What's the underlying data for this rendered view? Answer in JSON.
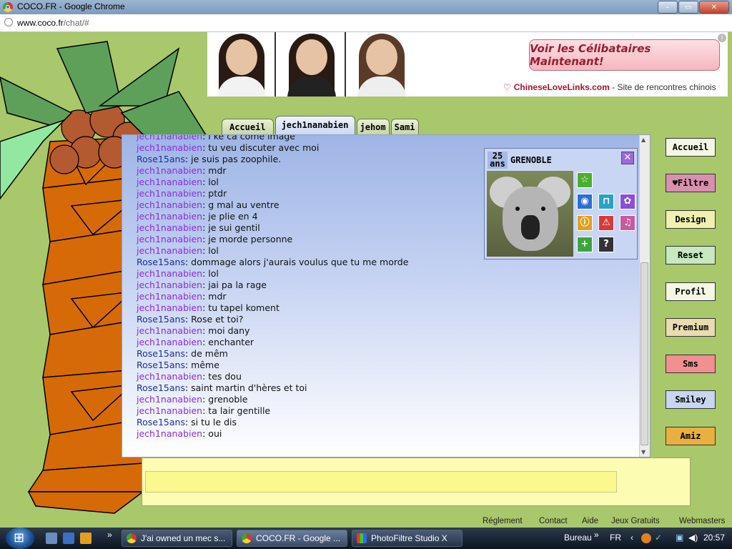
{
  "window": {
    "title": "COCO.FR - Google Chrome",
    "controls": [
      "–",
      "▭",
      "✕"
    ]
  },
  "address_bar": {
    "url_main": "www.coco.fr",
    "url_rest": "/chat/#"
  },
  "ad": {
    "cta": "Voir les Célibataires Maintenant!",
    "brand": "ChineseLoveLinks.com",
    "tagline": "- Site de rencontres chinois",
    "info": "i"
  },
  "tabs": [
    {
      "label": "Accueil",
      "active": false
    },
    {
      "label": "jech1nanabien",
      "active": true
    },
    {
      "label": "jehom",
      "active": false
    },
    {
      "label": "Sami",
      "active": false
    }
  ],
  "messages": [
    {
      "nick": "jech1nanabien",
      "text": "i ke ca come image",
      "who": "j"
    },
    {
      "nick": "jech1nanabien",
      "text": "tu veu discuter avec moi",
      "who": "j"
    },
    {
      "nick": "Rose15ans",
      "text": "je suis pas zoophile.",
      "who": "r"
    },
    {
      "nick": "jech1nanabien",
      "text": "mdr",
      "who": "j"
    },
    {
      "nick": "jech1nanabien",
      "text": "lol",
      "who": "j"
    },
    {
      "nick": "jech1nanabien",
      "text": "ptdr",
      "who": "j"
    },
    {
      "nick": "jech1nanabien",
      "text": "g mal au ventre",
      "who": "j"
    },
    {
      "nick": "jech1nanabien",
      "text": "je plie en 4",
      "who": "j"
    },
    {
      "nick": "jech1nanabien",
      "text": "je sui gentil",
      "who": "j"
    },
    {
      "nick": "jech1nanabien",
      "text": "je morde personne",
      "who": "j"
    },
    {
      "nick": "jech1nanabien",
      "text": "lol",
      "who": "j"
    },
    {
      "nick": "Rose15ans",
      "text": "dommage alors j'aurais voulus que tu me morde",
      "who": "r"
    },
    {
      "nick": "jech1nanabien",
      "text": "lol",
      "who": "j"
    },
    {
      "nick": "jech1nanabien",
      "text": "jai pa la rage",
      "who": "j"
    },
    {
      "nick": "jech1nanabien",
      "text": "mdr",
      "who": "j"
    },
    {
      "nick": "jech1nanabien",
      "text": "tu tapel koment",
      "who": "j"
    },
    {
      "nick": "Rose15ans",
      "text": "Rose et toi?",
      "who": "r"
    },
    {
      "nick": "jech1nanabien",
      "text": "moi dany",
      "who": "j"
    },
    {
      "nick": "jech1nanabien",
      "text": "enchanter",
      "who": "j"
    },
    {
      "nick": "Rose15ans",
      "text": "de mêm",
      "who": "r"
    },
    {
      "nick": "Rose15ans",
      "text": "même",
      "who": "r"
    },
    {
      "nick": "jech1nanabien",
      "text": "tes dou",
      "who": "j"
    },
    {
      "nick": "Rose15ans",
      "text": "saint martin d'hères et toi",
      "who": "r"
    },
    {
      "nick": "jech1nanabien",
      "text": "grenoble",
      "who": "j"
    },
    {
      "nick": "jech1nanabien",
      "text": "ta lair gentille",
      "who": "j"
    },
    {
      "nick": "Rose15ans",
      "text": "si tu le dis",
      "who": "r"
    },
    {
      "nick": "jech1nanabien",
      "text": "oui",
      "who": "j"
    }
  ],
  "profile": {
    "age": "25",
    "age_unit": "ans",
    "city": "GRENOBLE",
    "close": "✕",
    "icons": [
      {
        "name": "star-icon",
        "glyph": "☆",
        "color": "#4caf2a"
      },
      {
        "name": "webcam-icon",
        "glyph": "◉",
        "color": "#2a6fd6"
      },
      {
        "name": "car-icon",
        "glyph": "⊓",
        "color": "#2aa2c8"
      },
      {
        "name": "flower-icon",
        "glyph": "✿",
        "color": "#8a4fd6"
      },
      {
        "name": "info-icon",
        "glyph": "ⓘ",
        "color": "#e0a020"
      },
      {
        "name": "warning-icon",
        "glyph": "⚠",
        "color": "#d63a3a"
      },
      {
        "name": "microphone-icon",
        "glyph": "♫",
        "color": "#c95aa0"
      },
      {
        "name": "add-icon",
        "glyph": "+",
        "color": "#3aa63a"
      },
      {
        "name": "help-icon",
        "glyph": "?",
        "color": "#333333"
      }
    ]
  },
  "nav_buttons": [
    {
      "label": "Accueil",
      "bg": "#f3f7e4"
    },
    {
      "label": "♥Filtre",
      "bg": "#d98fb0"
    },
    {
      "label": "Design",
      "bg": "#f0f0b0"
    },
    {
      "label": "Reset",
      "bg": "#c8e8c0"
    },
    {
      "label": "Profil",
      "bg": "#f3f7e4"
    },
    {
      "label": "Premium",
      "bg": "#e8dcb0"
    },
    {
      "label": "Sms",
      "bg": "#f09090"
    },
    {
      "label": "Smiley",
      "bg": "#c8d6f0"
    },
    {
      "label": "Amiz",
      "bg": "#e8b040"
    }
  ],
  "input": {
    "value": ""
  },
  "footer_links": [
    "Réglement",
    "Contact",
    "Aide",
    "Jeux Gratuits",
    "Webmasters"
  ],
  "taskbar": {
    "buttons": [
      {
        "label": "J'ai owned un mec s...",
        "active": false
      },
      {
        "label": "COCO.FR - Google ...",
        "active": true
      },
      {
        "label": "PhotoFiltre Studio X",
        "active": false
      }
    ],
    "bureau": "Bureau",
    "chevron": "»",
    "lang": "FR",
    "time": "20:57"
  }
}
